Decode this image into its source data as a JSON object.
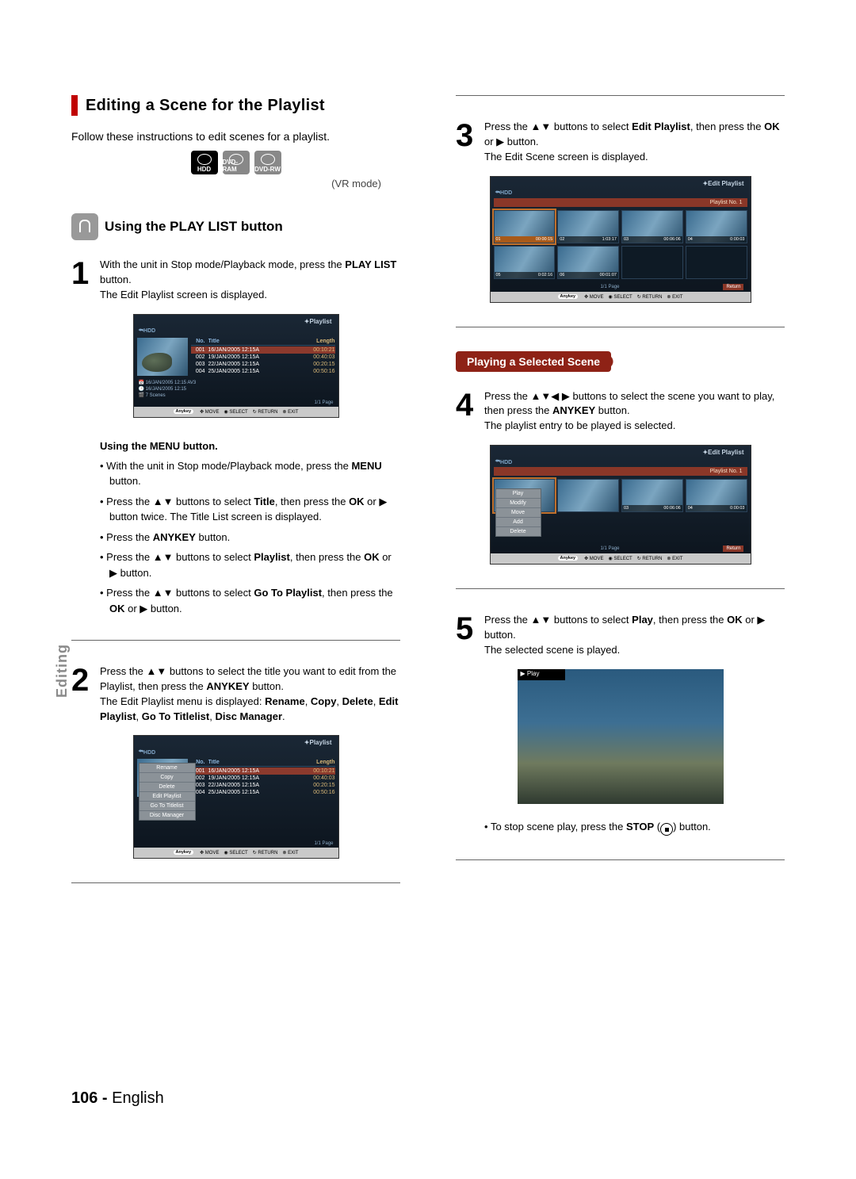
{
  "left": {
    "section_title": "Editing a Scene for the Playlist",
    "intro": "Follow these instructions to edit scenes for a playlist.",
    "media_icons": {
      "hdd": "HDD",
      "ram": "DVD-RAM",
      "rw": "DVD-RW"
    },
    "vr_mode": "(VR mode)",
    "subsection_title": "Using the PLAY LIST button",
    "step1": {
      "num": "1",
      "line1_a": "With the unit in Stop mode/Playback mode, press the ",
      "line1_b": "PLAY LIST",
      "line1_c": " button.",
      "line2": "The Edit Playlist screen is displayed."
    },
    "osd1": {
      "title": "Playlist",
      "hdd": "HDD",
      "cols": {
        "no": "No.",
        "title": "Title",
        "len": "Length"
      },
      "rows": [
        {
          "no": "001",
          "title": "16/JAN/2005 12:15A",
          "len": "00:10:21"
        },
        {
          "no": "002",
          "title": "19/JAN/2005 12:15A",
          "len": "00:40:03"
        },
        {
          "no": "003",
          "title": "22/JAN/2005 12:15A",
          "len": "00:20:15"
        },
        {
          "no": "004",
          "title": "25/JAN/2005 12:15A",
          "len": "00:50:16"
        }
      ],
      "meta1": "16/JAN/2005 12:15 AV3",
      "meta2": "16/JAN/2005 12:15",
      "meta3": "7 Scenes",
      "page": "1/1 Page",
      "footer": {
        "anykey": "Anykey",
        "move": "MOVE",
        "select": "SELECT",
        "ret": "RETURN",
        "exit": "EXIT"
      }
    },
    "menu_heading": "Using the MENU button.",
    "menu_bullets": {
      "b1a": "With the unit in Stop mode/Playback mode, press the ",
      "b1b": "MENU",
      "b1c": " button.",
      "b2a": "Press the ▲▼ buttons to select ",
      "b2b": "Title",
      "b2c": ", then press the ",
      "b2d": "OK",
      "b2e": " or ▶ button twice. The Title List screen is displayed.",
      "b3a": "Press the ",
      "b3b": "ANYKEY",
      "b3c": " button.",
      "b4a": "Press the ▲▼ buttons to select ",
      "b4b": "Playlist",
      "b4c": ", then press the ",
      "b4d": "OK",
      "b4e": " or ▶ button.",
      "b5a": "Press the ▲▼ buttons to select ",
      "b5b": "Go To Playlist",
      "b5c": ", then press the ",
      "b5d": "OK",
      "b5e": " or ▶ button."
    },
    "step2": {
      "num": "2",
      "l1a": "Press the ▲▼ buttons to select the title you want to edit from the Playlist, then press the ",
      "l1b": "ANYKEY",
      "l1c": " button.",
      "l2a": "The Edit Playlist menu is displayed: ",
      "l2b": "Rename",
      "l2c": ", ",
      "l2d": "Copy",
      "l2e": ", ",
      "l2f": "Delete",
      "l2g": ", ",
      "l2h": "Edit Playlist",
      "l2i": ", ",
      "l2j": "Go To Titlelist",
      "l2k": ", ",
      "l2l": "Disc Manager",
      "l2m": "."
    },
    "osd2": {
      "title": "Playlist",
      "hdd": "HDD",
      "cols": {
        "no": "No.",
        "title": "Title",
        "len": "Length"
      },
      "rows": [
        {
          "no": "001",
          "title": "16/JAN/2005 12:15A",
          "len": "00:10:21"
        },
        {
          "no": "002",
          "title": "19/JAN/2005 12:15A",
          "len": "00:40:03"
        },
        {
          "no": "003",
          "title": "22/JAN/2005 12:15A",
          "len": "00:20:15"
        },
        {
          "no": "004",
          "title": "25/JAN/2005 12:15A",
          "len": "00:50:16"
        }
      ],
      "context": [
        "Rename",
        "Copy",
        "Delete",
        "Edit Playlist",
        "Go To Titlelist",
        "Disc Manager"
      ],
      "page": "1/1 Page",
      "footer": {
        "anykey": "Anykey",
        "move": "MOVE",
        "select": "SELECT",
        "ret": "RETURN",
        "exit": "EXIT"
      }
    }
  },
  "right": {
    "step3": {
      "num": "3",
      "l1a": "Press the ▲▼ buttons to select ",
      "l1b": "Edit Playlist",
      "l1c": ", then press the ",
      "l1d": "OK",
      "l1e": " or ▶ button.",
      "l2": "The Edit Scene screen is displayed."
    },
    "osd3": {
      "title": "Edit Playlist",
      "hdd": "HDD",
      "playlist_label": "Playlist No. 1",
      "scenes": [
        {
          "no": "01",
          "time": "00:00:15"
        },
        {
          "no": "02",
          "time": "1:03:17"
        },
        {
          "no": "03",
          "time": "00:06:06"
        },
        {
          "no": "04",
          "time": "0:00:03"
        },
        {
          "no": "05",
          "time": "0:02:16"
        },
        {
          "no": "06",
          "time": "00:01:07"
        }
      ],
      "page": "1/1 Page",
      "return": "Return",
      "footer": {
        "anykey": "Anykey",
        "move": "MOVE",
        "select": "SELECT",
        "ret": "RETURN",
        "exit": "EXIT"
      }
    },
    "sub_title": "Playing a Selected Scene",
    "step4": {
      "num": "4",
      "l1a": "Press the ▲▼◀ ▶ buttons to select the scene you want to play, then press the ",
      "l1b": "ANYKEY",
      "l1c": " button.",
      "l2": "The playlist entry to be played is selected."
    },
    "osd4": {
      "title": "Edit Playlist",
      "hdd": "HDD",
      "playlist_label": "Playlist No. 1",
      "context": [
        "Play",
        "Modify",
        "Move",
        "Add",
        "Delete"
      ],
      "scenes_top": [
        {
          "no": "03",
          "time": "00:06:06"
        },
        {
          "no": "04",
          "time": "0:00:03"
        }
      ],
      "page": "1/1 Page",
      "return": "Return",
      "footer": {
        "anykey": "Anykey",
        "move": "MOVE",
        "select": "SELECT",
        "ret": "RETURN",
        "exit": "EXIT"
      }
    },
    "step5": {
      "num": "5",
      "l1a": "Press the ▲▼ buttons to select ",
      "l1b": "Play",
      "l1c": ", then press the ",
      "l1d": "OK",
      "l1e": " or ▶ button.",
      "l2": "The selected scene is played."
    },
    "play_badge": "▶  Play",
    "note_a": "To stop scene play, press the ",
    "note_b": "STOP",
    "note_c": " (      ) button."
  },
  "side_label": "Editing",
  "footer": {
    "page": "106 - ",
    "lang": "English"
  }
}
